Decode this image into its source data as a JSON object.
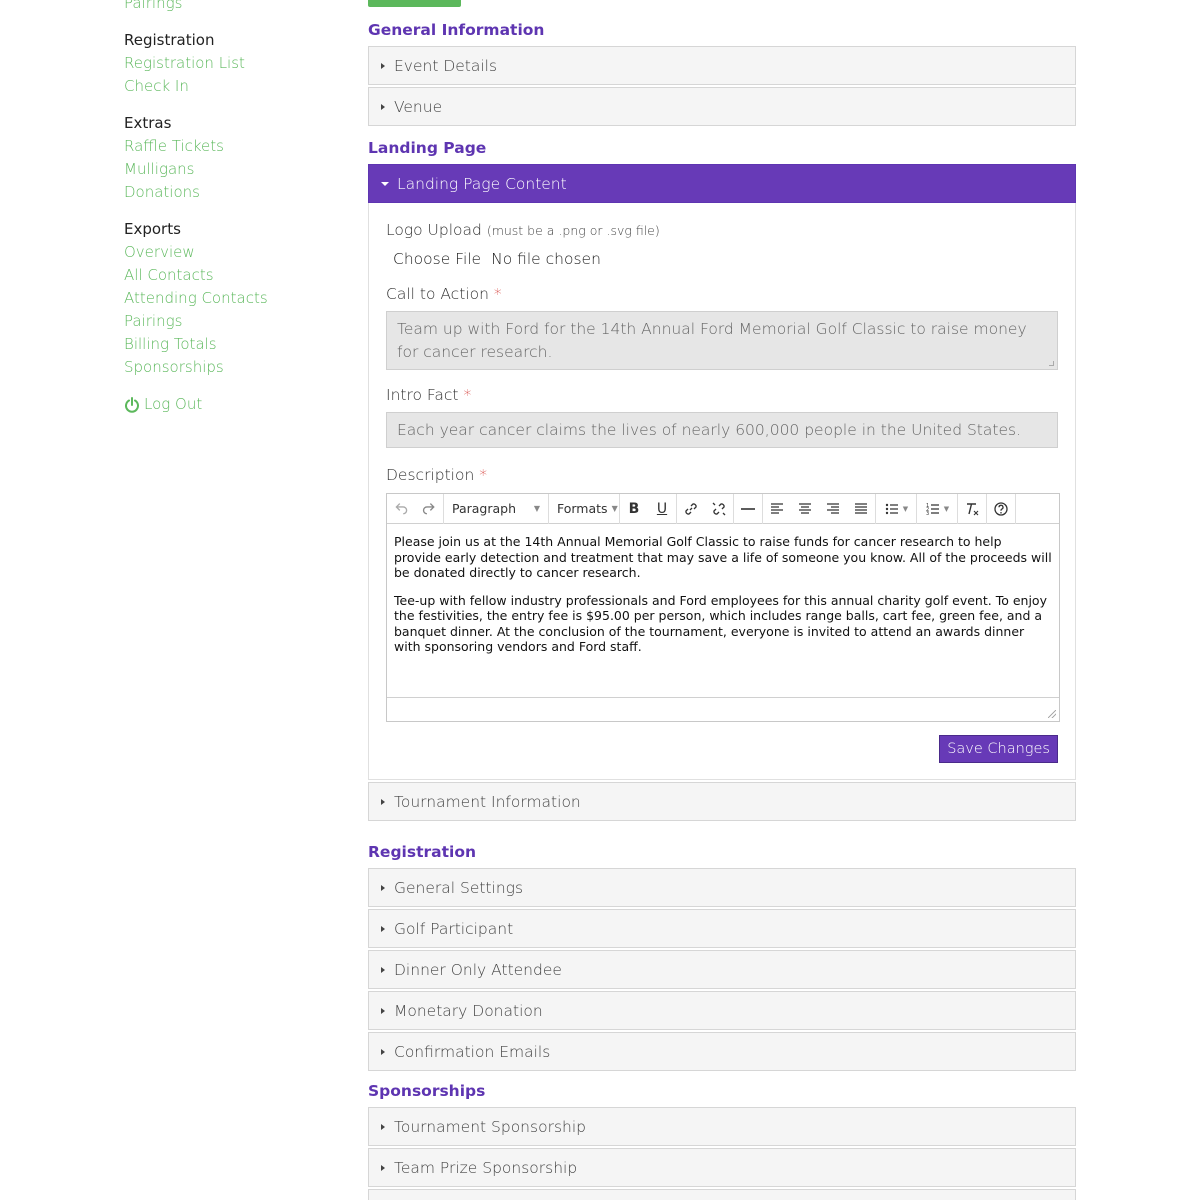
{
  "sidebar": {
    "top_link": "Pairings",
    "groups": [
      {
        "title": "Registration",
        "links": [
          "Registration List",
          "Check In"
        ]
      },
      {
        "title": "Extras",
        "links": [
          "Raffle Tickets",
          "Mulligans",
          "Donations"
        ]
      },
      {
        "title": "Exports",
        "links": [
          "Overview",
          "All Contacts",
          "Attending Contacts",
          "Pairings",
          "Billing Totals",
          "Sponsorships"
        ]
      }
    ],
    "logout": "Log Out"
  },
  "sections": {
    "general": {
      "title": "General Information",
      "panels": [
        "Event Details",
        "Venue"
      ]
    },
    "landing": {
      "title": "Landing Page",
      "open_panel": "Landing Page Content",
      "after_panel": "Tournament Information"
    },
    "registration": {
      "title": "Registration",
      "panels": [
        "General Settings",
        "Golf Participant",
        "Dinner Only Attendee",
        "Monetary Donation",
        "Confirmation Emails"
      ]
    },
    "sponsorships": {
      "title": "Sponsorships",
      "panels": [
        "Tournament Sponsorship",
        "Team Prize Sponsorship"
      ]
    }
  },
  "form": {
    "logo_label": "Logo Upload",
    "logo_hint": "(must be a .png or .svg file)",
    "choose_file": "Choose File",
    "no_file": "No file chosen",
    "cta_label": "Call to Action",
    "cta_value": "Team up with Ford for the 14th Annual Ford Memorial Golf Classic to raise money for cancer research.",
    "fact_label": "Intro Fact",
    "fact_value": "Each year cancer claims the lives of nearly 600,000 people in the United States.",
    "desc_label": "Description",
    "required_mark": "*",
    "editor": {
      "paragraph": "Paragraph",
      "formats": "Formats",
      "bold": "B",
      "underline": "U",
      "p1": "Please join us at the 14th Annual Memorial Golf Classic to raise funds for cancer research to help provide early detection and treatment that may save a life of someone you know. All of the proceeds will be donated directly to cancer research.",
      "p2": "Tee-up with fellow industry professionals and Ford employees for this annual charity golf event. To enjoy the festivities, the entry fee is $95.00 per person, which includes range balls, cart fee, green fee, and a banquet dinner. At the conclusion of the tournament, everyone is invited to attend an awards dinner with sponsoring vendors and Ford staff."
    },
    "save": "Save Changes"
  },
  "colors": {
    "brand_purple": "#673ab7",
    "link_green": "#5cb85c",
    "required_red": "#d9534f"
  }
}
